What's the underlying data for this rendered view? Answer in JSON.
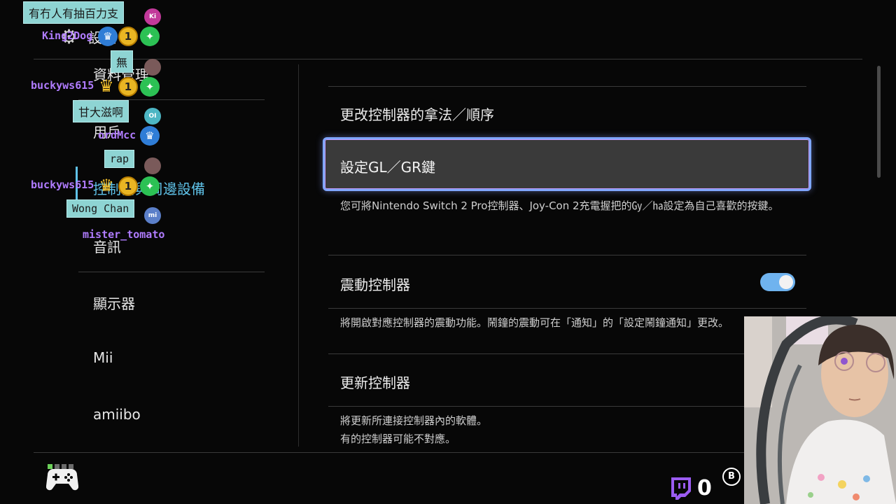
{
  "sidebar": {
    "items": [
      {
        "label": "設定"
      },
      {
        "label": "資料管理"
      },
      {
        "label": "用戶"
      },
      {
        "label": "控制器與周邊設備"
      },
      {
        "label": "音訊"
      },
      {
        "label": "顯示器"
      },
      {
        "label": "Mii"
      },
      {
        "label": "amiibo"
      }
    ]
  },
  "main": {
    "row1": {
      "title": "更改控制器的拿法／順序"
    },
    "row2": {
      "title": "設定GL／GR鍵",
      "desc": "您可將Nintendo Switch 2 Pro控制器、Joy-Con 2充電握把的㏉／㏊設定為自己喜歡的按鍵。"
    },
    "row3": {
      "title": "震動控制器",
      "toggle_on": true,
      "desc": "將開啟對應控制器的震動功能。鬧鐘的震動可在「通知」的「設定鬧鐘通知」更改。"
    },
    "row4": {
      "title": "更新控制器",
      "desc1": "將更新所連接控制器內的軟體。",
      "desc2": "有的控制器可能不對應。"
    }
  },
  "bottom": {
    "points": "0",
    "back_button": "B"
  },
  "chat": [
    {
      "message": "有冇人有抽百力支",
      "username": "King2Dog",
      "avatar": "Ki",
      "user_color": "#b07cff"
    },
    {
      "message": "無",
      "username": "buckyws615",
      "avatar": "",
      "user_color": "#b07cff"
    },
    {
      "message": "甘大滋啊",
      "username": "ordMcc",
      "avatar": "OI",
      "user_color": "#b07cff"
    },
    {
      "message": "rap",
      "username": "buckyws615",
      "avatar": "",
      "user_color": "#b07cff"
    },
    {
      "message": "Wong Chan",
      "username": "mister_tomato",
      "avatar": "mi",
      "user_color": "#b07cff"
    }
  ],
  "colors": {
    "accent": "#6fb3ef",
    "selection_border": "#7fa6ff",
    "chat_bubble": "#8ed4d3"
  }
}
